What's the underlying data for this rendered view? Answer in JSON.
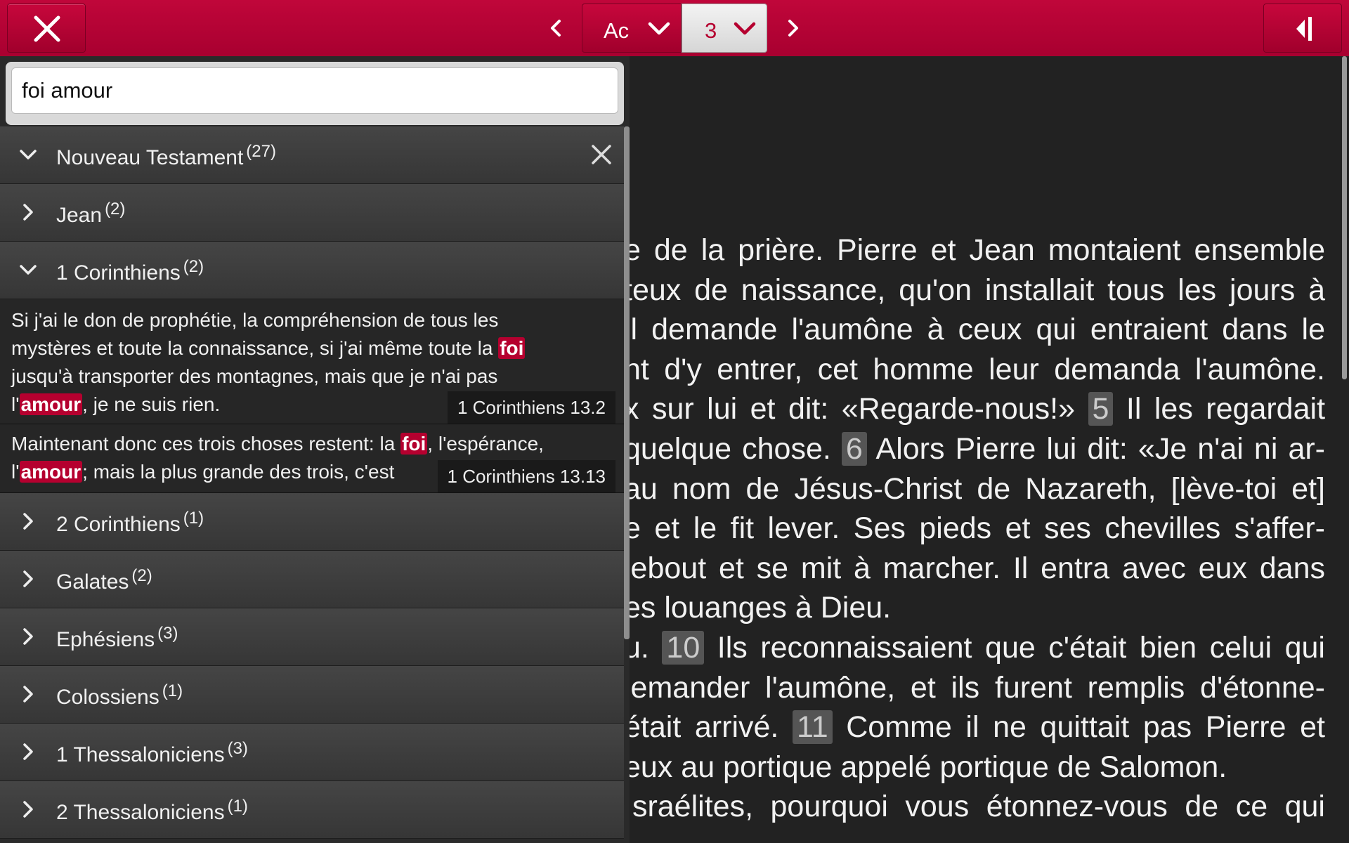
{
  "colors": {
    "accent": "#b5002f",
    "bar": "#c0063a"
  },
  "toolbar": {
    "close_icon": "close-icon",
    "prev_icon": "chevron-left-icon",
    "next_icon": "chevron-right-icon",
    "book_label": "Ac",
    "chapter_label": "3",
    "panel_icon": "collapse-panel-icon"
  },
  "search": {
    "value": "foi amour"
  },
  "reader": {
    "lines": [
      "e de la prière. Pierre et Jean montaient ensemble",
      "teux de naissance, qu'on installait tous les jours à",
      "il demande l'aumône à ceux qui entraient dans le",
      "nt d'y entrer, cet homme leur demanda l'aumône.",
      "x sur lui et dit: «Regarde-nous!»",
      "quelque chose.",
      "au nom de Jésus-Christ de Nazareth, [lève-toi et]",
      "e et le fit lever. Ses pieds et ses chevilles s'affer-",
      "lebout et se mit à marcher. Il entra avec eux dans",
      "es louanges à Dieu.",
      "u.",
      "lemander l'aumône, et ils furent remplis d'étonne-",
      "était arrivé.",
      "eux au portique appelé portique de Salomon.",
      "Israélites, pourquoi vous étonnez-vous de ce qui"
    ],
    "line5_rest": "Il les regardait",
    "line6_rest": "Alors Pierre lui dit: «Je n'ai ni ar-",
    "line11_rest": "Ils reconnaissaient que c'était bien celui qui",
    "line13_rest": "Comme il ne quittait pas Pierre et",
    "verse_5": "5",
    "verse_6": "6",
    "verse_10": "10",
    "verse_11": "11"
  },
  "results": {
    "testament": {
      "name": "Nouveau Testament",
      "count": "(27)"
    },
    "books": [
      {
        "name": "Jean",
        "count": "(2)"
      },
      {
        "name": "1 Corinthiens",
        "count": "(2)"
      },
      {
        "name": "2 Corinthiens",
        "count": "(1)"
      },
      {
        "name": "Galates",
        "count": "(2)"
      },
      {
        "name": "Ephésiens",
        "count": "(3)"
      },
      {
        "name": "Colossiens",
        "count": "(1)"
      },
      {
        "name": "1 Thessaloniciens",
        "count": "(3)"
      },
      {
        "name": "2 Thessaloniciens",
        "count": "(1)"
      }
    ],
    "verses": [
      {
        "l1": "Si j'ai le don de prophétie, la compréhension de tous les",
        "l2a": "mystères et toute la connaissance, si j'ai même toute la ",
        "hl1": "foi",
        "l3": "jusqu'à transporter des montagnes, mais que je n'ai pas",
        "l4a": "l'",
        "hl2": "amour",
        "l4b": ", je ne suis rien.",
        "ref": "1 Corinthiens 13.2"
      },
      {
        "l1a": "Maintenant donc ces trois choses restent: la ",
        "hl1": "foi",
        "l1b": ", l'espérance,",
        "l2a": "l'",
        "hl2": "amour",
        "l2b": "; mais la plus grande des trois, c'est",
        "ref": "1 Corinthiens 13.13"
      }
    ]
  }
}
